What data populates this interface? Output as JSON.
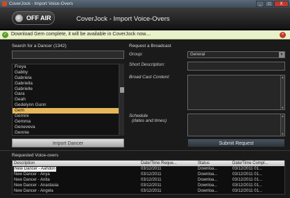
{
  "window": {
    "title": "CoverJock - Import Voice-Overs",
    "min_label": "_",
    "max_label": "□",
    "close_label": "X"
  },
  "header": {
    "offair_label": "OFF AIR",
    "app_title": "CoverJock - Import Voice-Overs"
  },
  "notification": {
    "icon": "check-icon",
    "icon_glyph": "✓",
    "message": "Download Gem complete, it will be available in CoverJock now....",
    "close_glyph": "×"
  },
  "search_panel": {
    "label": "Search for a Dancer (1342)",
    "search_value": "",
    "dancers": [
      "Freya",
      "Gabby",
      "Gabriela",
      "Gabriella",
      "Gabrielle",
      "Gara",
      "Geah",
      "Gedelynn Gunn",
      "Gem",
      "Gemini",
      "Gemma",
      "Geneveva",
      "Gennie",
      "George",
      "Georgia"
    ],
    "selected_dancer": "Gem",
    "import_button": "Import Dancer"
  },
  "request_panel": {
    "label": "Request a Broadcast",
    "group_label": "Group:",
    "group_value": "General",
    "short_desc_label": "Short Description:",
    "short_desc_value": "",
    "broadcast_content_label": "Broad Cast Content:",
    "broadcast_content_value": "",
    "schedule_label": "Schedule",
    "schedule_sublabel": "(dates and times)",
    "schedule_value": "",
    "submit_button": "Submit Request"
  },
  "voiceovers": {
    "label": "Requested Voice-overs",
    "columns": [
      "Description",
      "Date/Time Reque...",
      "Status",
      "Date/Time Compl..."
    ],
    "rows": [
      [
        "New Dancer - Aahdon",
        "03/12/2011",
        "Downloa...",
        "03/12/2011 01..."
      ],
      [
        "New Dancer - Anya",
        "03/12/2011",
        "Downloa...",
        "03/12/2011 01..."
      ],
      [
        "New Dancer - Anita",
        "03/12/2011",
        "Downloa...",
        "03/12/2011 01..."
      ],
      [
        "New Dancer - Anastasia",
        "03/12/2011",
        "Downloa...",
        "03/12/2011 01..."
      ],
      [
        "New Dancer - Angela",
        "03/12/2011",
        "Downloa...",
        "03/12/2011 01..."
      ]
    ]
  },
  "colors": {
    "selection": "#e6b75a",
    "notify_bg": "#e9f1c9",
    "background": "#1a1a1a"
  }
}
